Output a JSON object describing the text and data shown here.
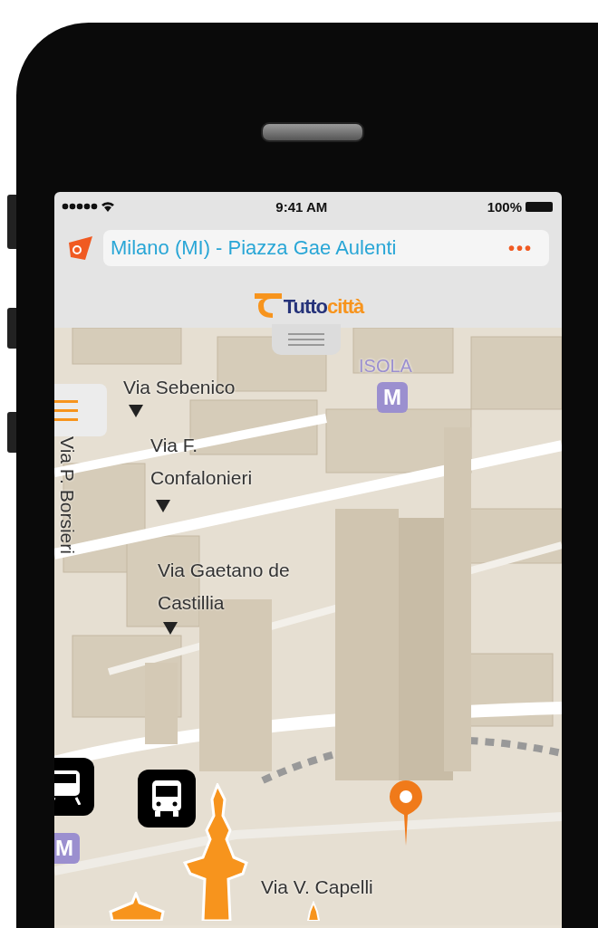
{
  "status_bar": {
    "time": "9:41 AM",
    "battery": "100%"
  },
  "search": {
    "value": "Milano (MI) - Piazza Gae Aulenti",
    "more": "•••"
  },
  "logo": {
    "part_1": "Tutto",
    "part_2": "città"
  },
  "map": {
    "street_labels": [
      {
        "text": "Via Sebenico",
        "kind": "street"
      },
      {
        "text": "Via F.\nConfalonieri",
        "kind": "street"
      },
      {
        "text": "Via Gaetano de\nCastillia",
        "kind": "street"
      },
      {
        "text": "Via P. Borsieri",
        "kind": "vertical"
      },
      {
        "text": "Via V. Capelli",
        "kind": "street"
      },
      {
        "text": "ISOLA",
        "kind": "district"
      }
    ],
    "metro_badges": [
      "M",
      "M"
    ]
  }
}
